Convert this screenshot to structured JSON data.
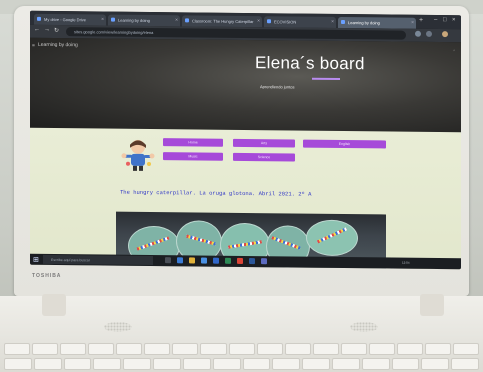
{
  "browser": {
    "tabs": [
      {
        "label": "My drive - Google Drive"
      },
      {
        "label": "Learning by doing"
      },
      {
        "label": "Classroom: The Hungry Caterpillar"
      },
      {
        "label": "ECOVISION"
      },
      {
        "label": "Learning by doing"
      }
    ],
    "url": "sites.google.com/view/learningbydoing/elena"
  },
  "site": {
    "name": "Learning by doing"
  },
  "page": {
    "title": "Elena´s board",
    "subtitle": "Aprendiendo juntos"
  },
  "buttons": [
    {
      "label": "Home"
    },
    {
      "label": "Arts"
    },
    {
      "label": "English"
    },
    {
      "label": "Music"
    },
    {
      "label": "Science"
    }
  ],
  "story": {
    "text": "The hungry caterpillar. La oruga glotona. Abril 2021. 2º A"
  },
  "taskbar": {
    "search_placeholder": "Escribe aquí para buscar",
    "time": "12:04"
  },
  "laptop": {
    "brand": "TOSHIBA"
  },
  "colors": {
    "accent_purple": "#a64ad9",
    "story_text": "#2f35c6",
    "content_bg": "#e9edd6"
  }
}
